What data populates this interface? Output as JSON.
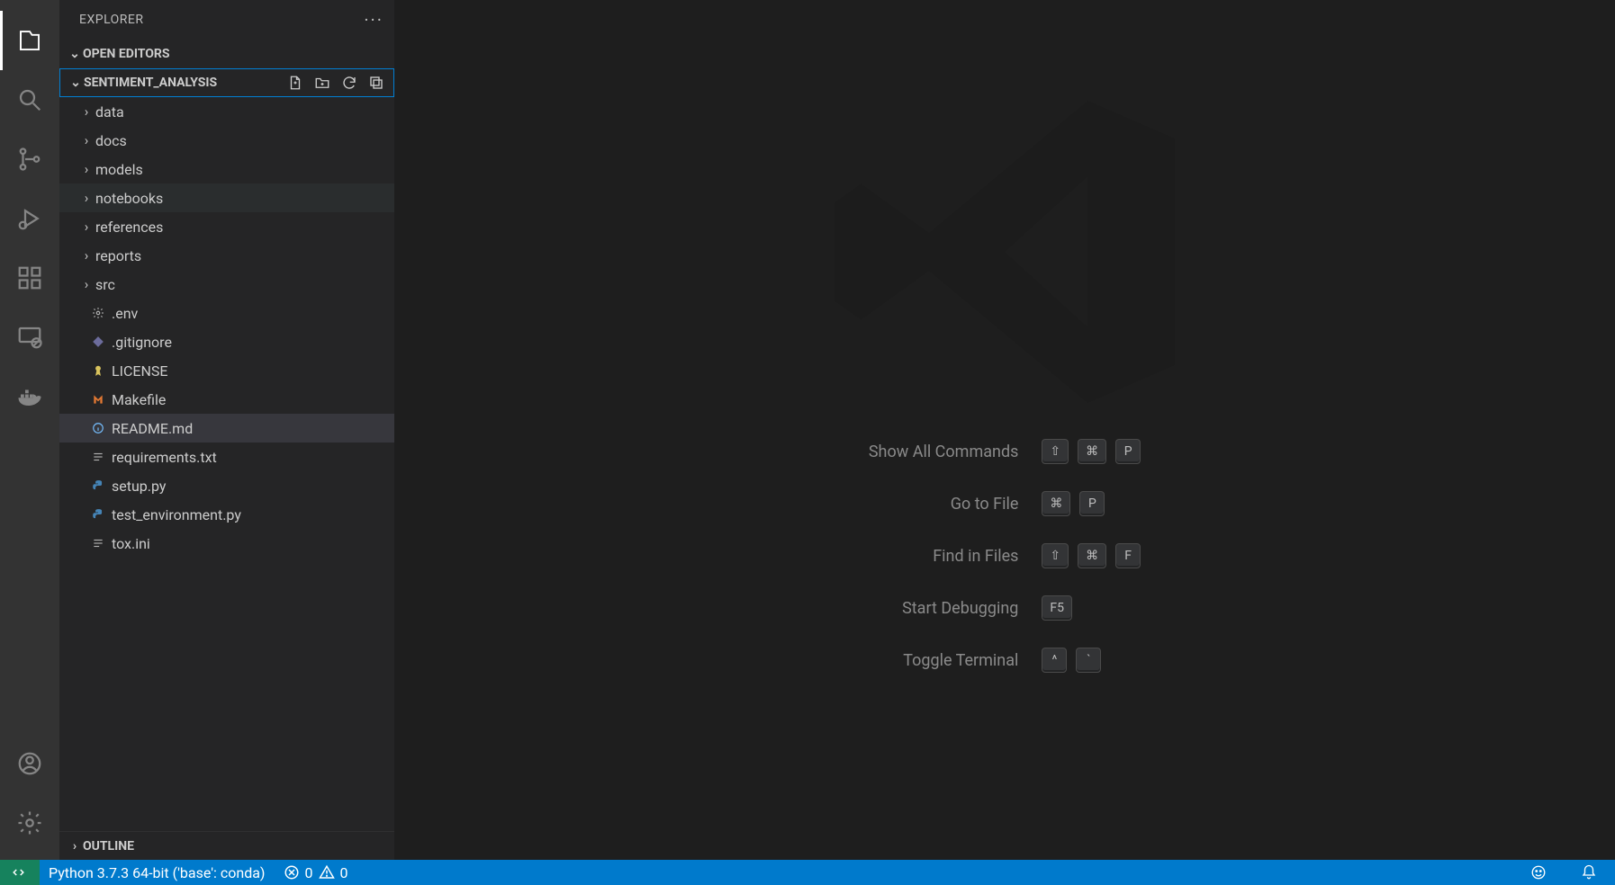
{
  "sidebar": {
    "title": "EXPLORER",
    "open_editors_label": "OPEN EDITORS",
    "outline_label": "OUTLINE",
    "project_name": "SENTIMENT_ANALYSIS",
    "folders": [
      {
        "name": "data"
      },
      {
        "name": "docs"
      },
      {
        "name": "models"
      },
      {
        "name": "notebooks",
        "hovered": true
      },
      {
        "name": "references"
      },
      {
        "name": "reports"
      },
      {
        "name": "src"
      }
    ],
    "files": [
      {
        "name": ".env",
        "icon": "gear",
        "color": "#b0b0b0"
      },
      {
        "name": ".gitignore",
        "icon": "git",
        "color": "#6c6c9c"
      },
      {
        "name": "LICENSE",
        "icon": "license",
        "color": "#d9c35c"
      },
      {
        "name": "Makefile",
        "icon": "makefile",
        "color": "#e37933"
      },
      {
        "name": "README.md",
        "icon": "info",
        "color": "#75beff",
        "selected": true
      },
      {
        "name": "requirements.txt",
        "icon": "lines",
        "color": "#b0b0b0"
      },
      {
        "name": "setup.py",
        "icon": "python",
        "color": "#4584b6"
      },
      {
        "name": "test_environment.py",
        "icon": "python",
        "color": "#4584b6"
      },
      {
        "name": "tox.ini",
        "icon": "lines",
        "color": "#b0b0b0"
      }
    ]
  },
  "editor": {
    "commands": [
      {
        "label": "Show All Commands",
        "keys": [
          "⇧",
          "⌘",
          "P"
        ]
      },
      {
        "label": "Go to File",
        "keys": [
          "⌘",
          "P"
        ]
      },
      {
        "label": "Find in Files",
        "keys": [
          "⇧",
          "⌘",
          "F"
        ]
      },
      {
        "label": "Start Debugging",
        "keys": [
          "F5"
        ]
      },
      {
        "label": "Toggle Terminal",
        "keys": [
          "^",
          "`"
        ]
      }
    ]
  },
  "status": {
    "python": "Python 3.7.3 64-bit ('base': conda)",
    "errors": "0",
    "warnings": "0"
  }
}
